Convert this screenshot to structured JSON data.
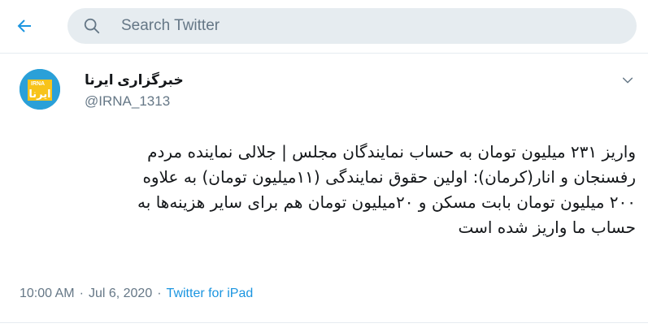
{
  "search": {
    "placeholder": "Search Twitter"
  },
  "tweet": {
    "display_name": "خبرگزاری ایرنا",
    "handle": "@IRNA_1313",
    "avatar_logo_text": "ایرنا IRNA",
    "text_lines": [
      "واریز ۲۳۱ میلیون تومان به حساب نمایندگان مجلس | جلالی نماینده مردم",
      "رفسنجان و انار(کرمان): اولین حقوق نمایندگی (۱۱میلیون تومان) به علاوه",
      "۲۰۰ میلیون تومان بابت مسکن و ۲۰میلیون تومان هم برای سایر هزینه‌ها به",
      "حساب ما واریز شده است"
    ],
    "time": "10:00 AM",
    "date": "Jul 6, 2020",
    "separator": "·",
    "source": "Twitter for iPad"
  },
  "colors": {
    "accent": "#1b95e0",
    "search_bg": "#e6ecf0",
    "secondary_text": "#657786",
    "avatar_bg": "#2aa0d8",
    "logo_yellow": "#f7c31a"
  },
  "icons": {
    "back": "arrow-left-icon",
    "search": "search-icon",
    "menu": "chevron-down-icon"
  }
}
